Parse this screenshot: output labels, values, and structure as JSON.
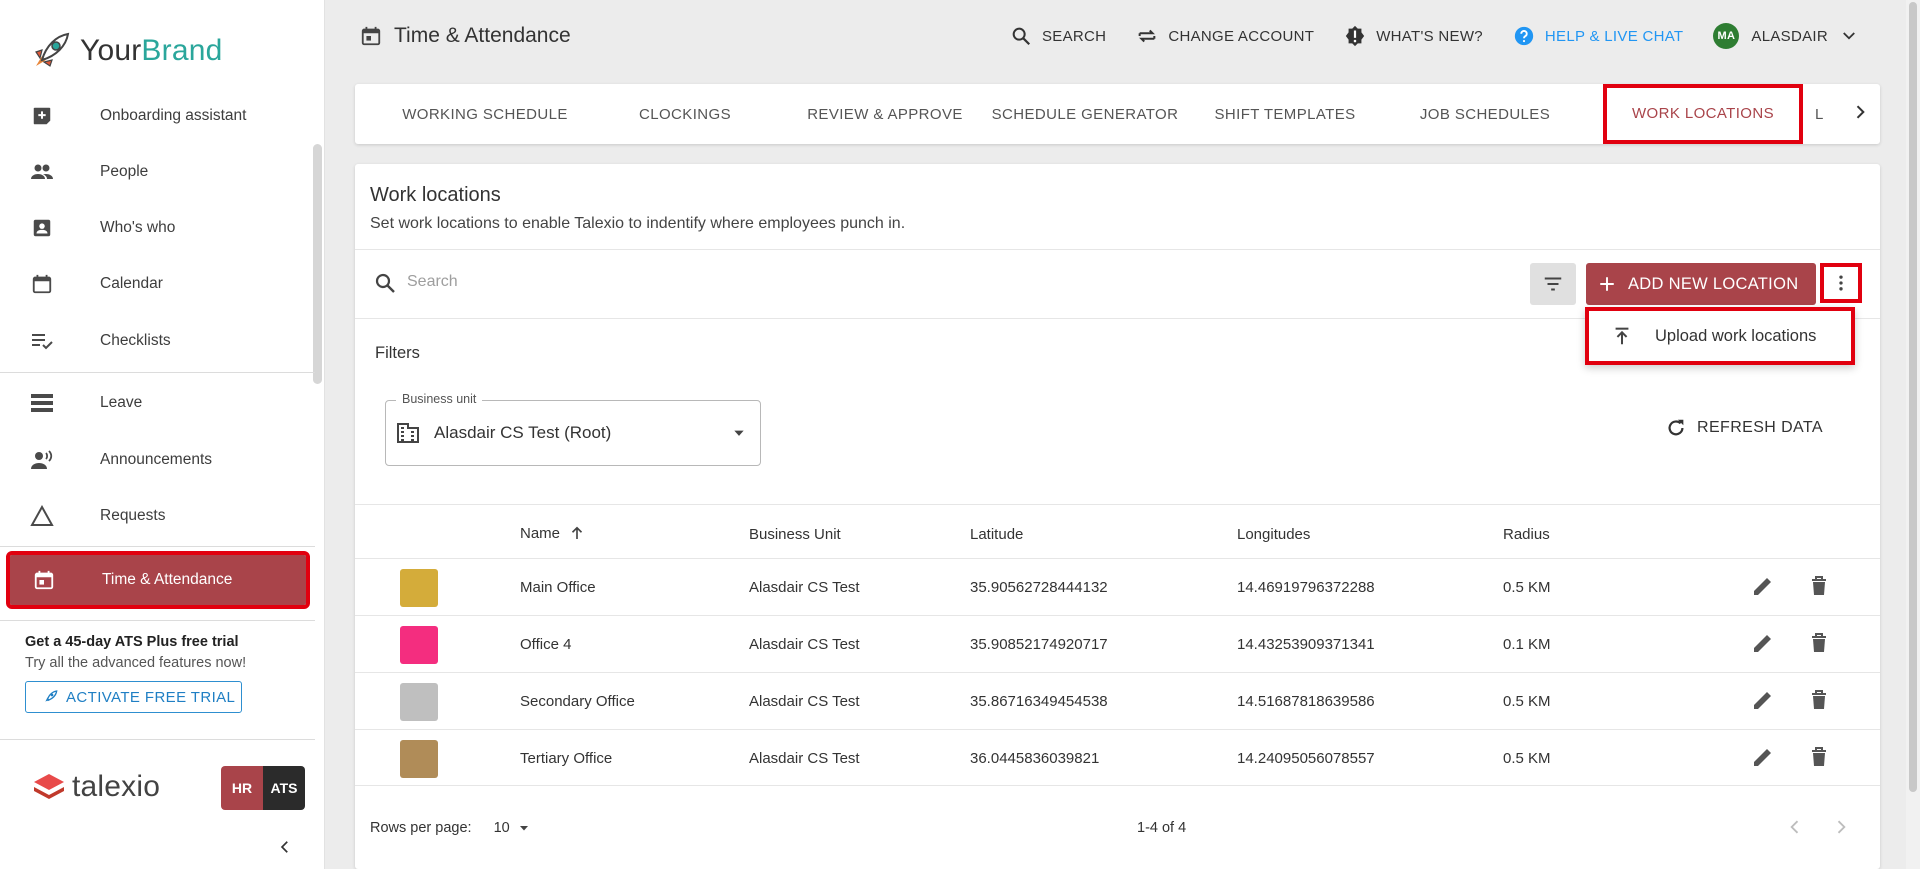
{
  "brand": {
    "name_part1": "Your",
    "name_part2": "Brand",
    "accent_color": "#2aa69b"
  },
  "sidebar": {
    "items": [
      {
        "label": "Onboarding assistant",
        "icon": "plus-box-icon"
      },
      {
        "label": "People",
        "icon": "people-icon"
      },
      {
        "label": "Who's who",
        "icon": "contact-card-icon"
      },
      {
        "label": "Calendar",
        "icon": "calendar-icon"
      },
      {
        "label": "Checklists",
        "icon": "checklist-icon"
      },
      {
        "label": "Leave",
        "icon": "leave-icon"
      },
      {
        "label": "Announcements",
        "icon": "announcement-icon"
      },
      {
        "label": "Requests",
        "icon": "triangle-icon"
      },
      {
        "label": "Time & Attendance",
        "icon": "time-calendar-icon",
        "active": true
      }
    ],
    "trial": {
      "title": "Get a 45-day ATS Plus free trial",
      "subtitle": "Try all the advanced features now!",
      "button": "ACTIVATE FREE TRIAL"
    },
    "footer_logo": "talexio",
    "badge_hr": "HR",
    "badge_ats": "ATS"
  },
  "header": {
    "title": "Time & Attendance",
    "search": "SEARCH",
    "change_account": "CHANGE ACCOUNT",
    "whats_new": "WHAT'S NEW?",
    "help": "HELP & LIVE CHAT",
    "avatar_initials": "MA",
    "user": "ALASDAIR"
  },
  "tabs": [
    {
      "label": "WORKING SCHEDULE"
    },
    {
      "label": "CLOCKINGS"
    },
    {
      "label": "REVIEW & APPROVE"
    },
    {
      "label": "SCHEDULE GENERATOR"
    },
    {
      "label": "SHIFT TEMPLATES"
    },
    {
      "label": "JOB SCHEDULES"
    },
    {
      "label": "WORK LOCATIONS",
      "active": true
    },
    {
      "label": "L"
    }
  ],
  "card": {
    "title": "Work locations",
    "subtitle": "Set work locations to enable Talexio to indentify where employees punch in.",
    "search_placeholder": "Search",
    "add_button": "ADD NEW LOCATION",
    "menu_item": "Upload work locations",
    "filters_label": "Filters",
    "business_unit_label": "Business unit",
    "business_unit_value": "Alasdair CS Test (Root)",
    "refresh": "REFRESH DATA"
  },
  "table": {
    "headers": [
      "Name",
      "Business Unit",
      "Latitude",
      "Longitudes",
      "Radius"
    ],
    "rows": [
      {
        "color": "#d4ac3a",
        "name": "Main Office",
        "unit": "Alasdair CS Test",
        "lat": "35.90562728444132",
        "lng": "14.46919796372288",
        "radius": "0.5 KM"
      },
      {
        "color": "#f42d7f",
        "name": "Office 4",
        "unit": "Alasdair CS Test",
        "lat": "35.90852174920717",
        "lng": "14.43253909371341",
        "radius": "0.1 KM"
      },
      {
        "color": "#bfbfbf",
        "name": "Secondary Office",
        "unit": "Alasdair CS Test",
        "lat": "35.86716349454538",
        "lng": "14.51687818639586",
        "radius": "0.5 KM"
      },
      {
        "color": "#b08c58",
        "name": "Tertiary Office",
        "unit": "Alasdair CS Test",
        "lat": "36.0445836039821",
        "lng": "14.24095056078557",
        "radius": "0.5 KM"
      }
    ],
    "rows_per_page_label": "Rows per page:",
    "rows_per_page": "10",
    "range": "1-4 of 4"
  },
  "colors": {
    "primary": "#a9444a",
    "highlight": "#e1000f",
    "link": "#2196f3"
  }
}
